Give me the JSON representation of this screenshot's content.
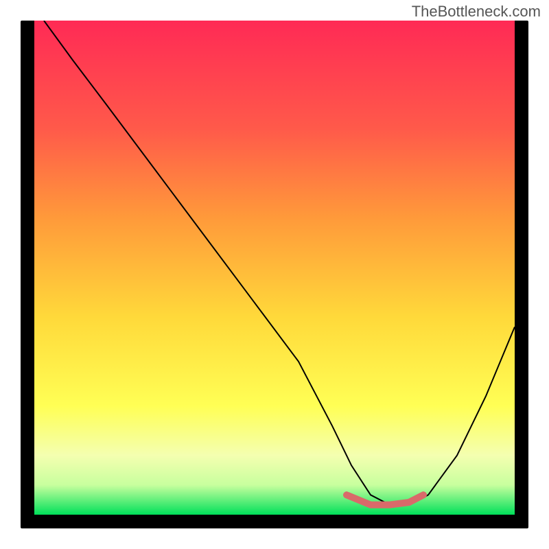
{
  "watermark": "TheBottleneck.com",
  "chart_data": {
    "type": "line",
    "title": "",
    "xlabel": "",
    "ylabel": "",
    "xlim": [
      0,
      100
    ],
    "ylim": [
      0,
      100
    ],
    "grid": false,
    "legend": false,
    "background_gradient": {
      "top": "#ff2a55",
      "mid_upper": "#ff8a3a",
      "mid": "#ffe83a",
      "mid_lower": "#ffff66",
      "lower": "#e6ffb3",
      "bottom": "#00e05a"
    },
    "series": [
      {
        "name": "curve",
        "color": "#000000",
        "x": [
          2,
          8,
          15,
          25,
          35,
          45,
          55,
          62,
          66,
          70,
          74,
          78,
          82,
          88,
          94,
          100
        ],
        "y": [
          100,
          92,
          83,
          70,
          57,
          44,
          31,
          18,
          10,
          4,
          2,
          2,
          4,
          12,
          24,
          38
        ]
      }
    ],
    "highlight_segment": {
      "name": "flat-red-segment",
      "color": "#d96a6a",
      "x": [
        65,
        70,
        74,
        78,
        81
      ],
      "y": [
        4,
        2,
        2,
        2.5,
        4
      ]
    }
  }
}
